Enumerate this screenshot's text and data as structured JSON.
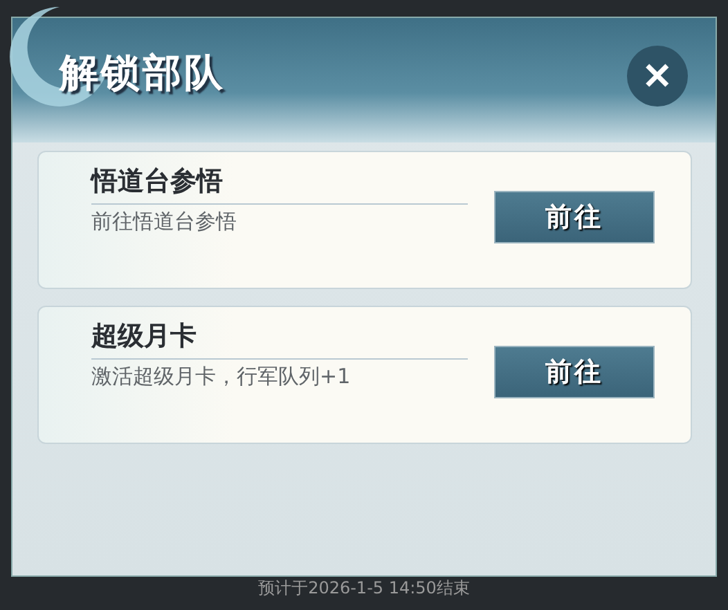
{
  "dialog": {
    "title": "解锁部队",
    "close_label": "✕"
  },
  "entries": [
    {
      "title": "悟道台参悟",
      "description": "前往悟道台参悟",
      "button": "前往"
    },
    {
      "title": "超级月卡",
      "description": "激活超级月卡，行军队列+1",
      "button": "前往"
    }
  ],
  "background_text": "预计于2026-1-5 14:50结束"
}
